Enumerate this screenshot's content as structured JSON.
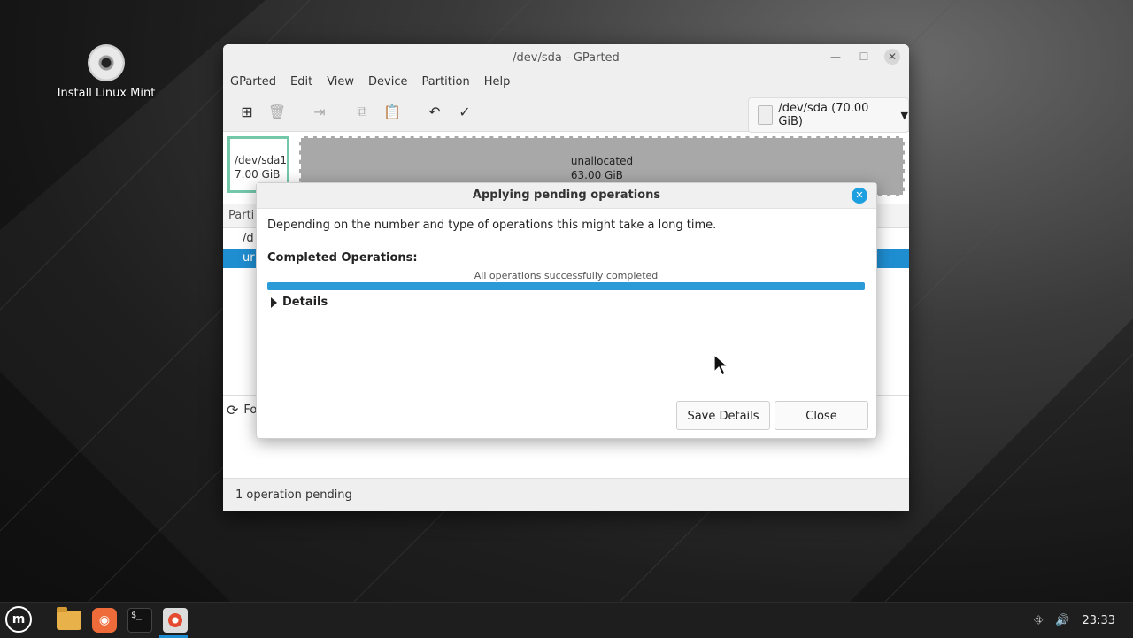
{
  "desktop": {
    "icon_label": "Install Linux Mint"
  },
  "window": {
    "title": "/dev/sda - GParted",
    "menu": [
      "GParted",
      "Edit",
      "View",
      "Device",
      "Partition",
      "Help"
    ],
    "device_selector": "/dev/sda (70.00 GiB)",
    "toolbar_icons": [
      "new-partition-icon",
      "delete-icon",
      "resize-move-icon",
      "copy-icon",
      "paste-icon",
      "undo-icon",
      "apply-icon"
    ]
  },
  "diskmap": {
    "sda1": {
      "name": "/dev/sda1",
      "size": "7.00 GiB"
    },
    "unallocated": {
      "name": "unallocated",
      "size": "63.00 GiB"
    }
  },
  "partition_list": {
    "header_partial": "Parti",
    "row1_partial": "/d",
    "row2_partial": "ur"
  },
  "operations_panel": {
    "item_partial": "Fo"
  },
  "statusbar": {
    "text": "1 operation pending"
  },
  "dialog": {
    "title": "Applying pending operations",
    "description": "Depending on the number and type of operations this might take a long time.",
    "completed_label": "Completed Operations:",
    "progress_text": "All operations successfully completed",
    "progress_fraction": 1.0,
    "details_label": "Details",
    "save_details_label": "Save Details",
    "close_label": "Close"
  },
  "taskbar": {
    "clock": "23:33",
    "terminal_glyph": "$_",
    "mint_glyph": "m"
  },
  "colors": {
    "accent": "#1f8ed1",
    "progress": "#2b9bd8",
    "sda1_border": "#73c8a9"
  }
}
